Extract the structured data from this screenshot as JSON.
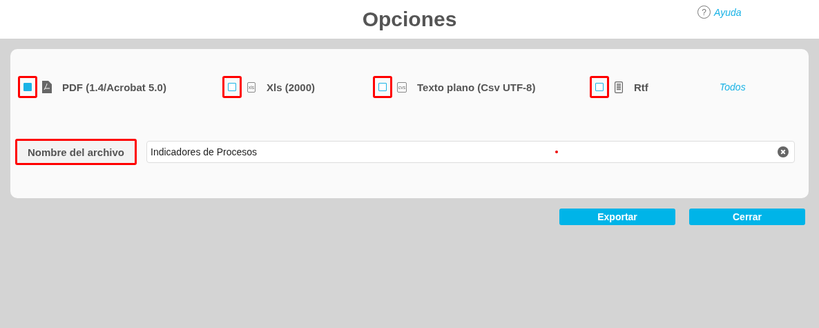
{
  "header": {
    "title": "Opciones",
    "help_icon": "?",
    "help_link": "Ayuda"
  },
  "formats": [
    {
      "kind": "pdf",
      "label": "PDF (1.4/Acrobat 5.0)",
      "checked": true,
      "highlighted": true
    },
    {
      "kind": "xls",
      "label": "Xls (2000)",
      "icon_text": "xls",
      "checked": false,
      "highlighted": true
    },
    {
      "kind": "csv",
      "label": "Texto plano (Csv UTF-8)",
      "icon_text": "cvs",
      "checked": false,
      "highlighted": true
    },
    {
      "kind": "rtf",
      "label": "Rtf",
      "checked": false,
      "highlighted": true
    }
  ],
  "select_all_link": "Todos",
  "filename": {
    "label": "Nombre del archivo",
    "highlighted": true,
    "value": "Indicadores de Procesos",
    "required": true
  },
  "buttons": [
    "Exportar",
    "Cerrar"
  ]
}
